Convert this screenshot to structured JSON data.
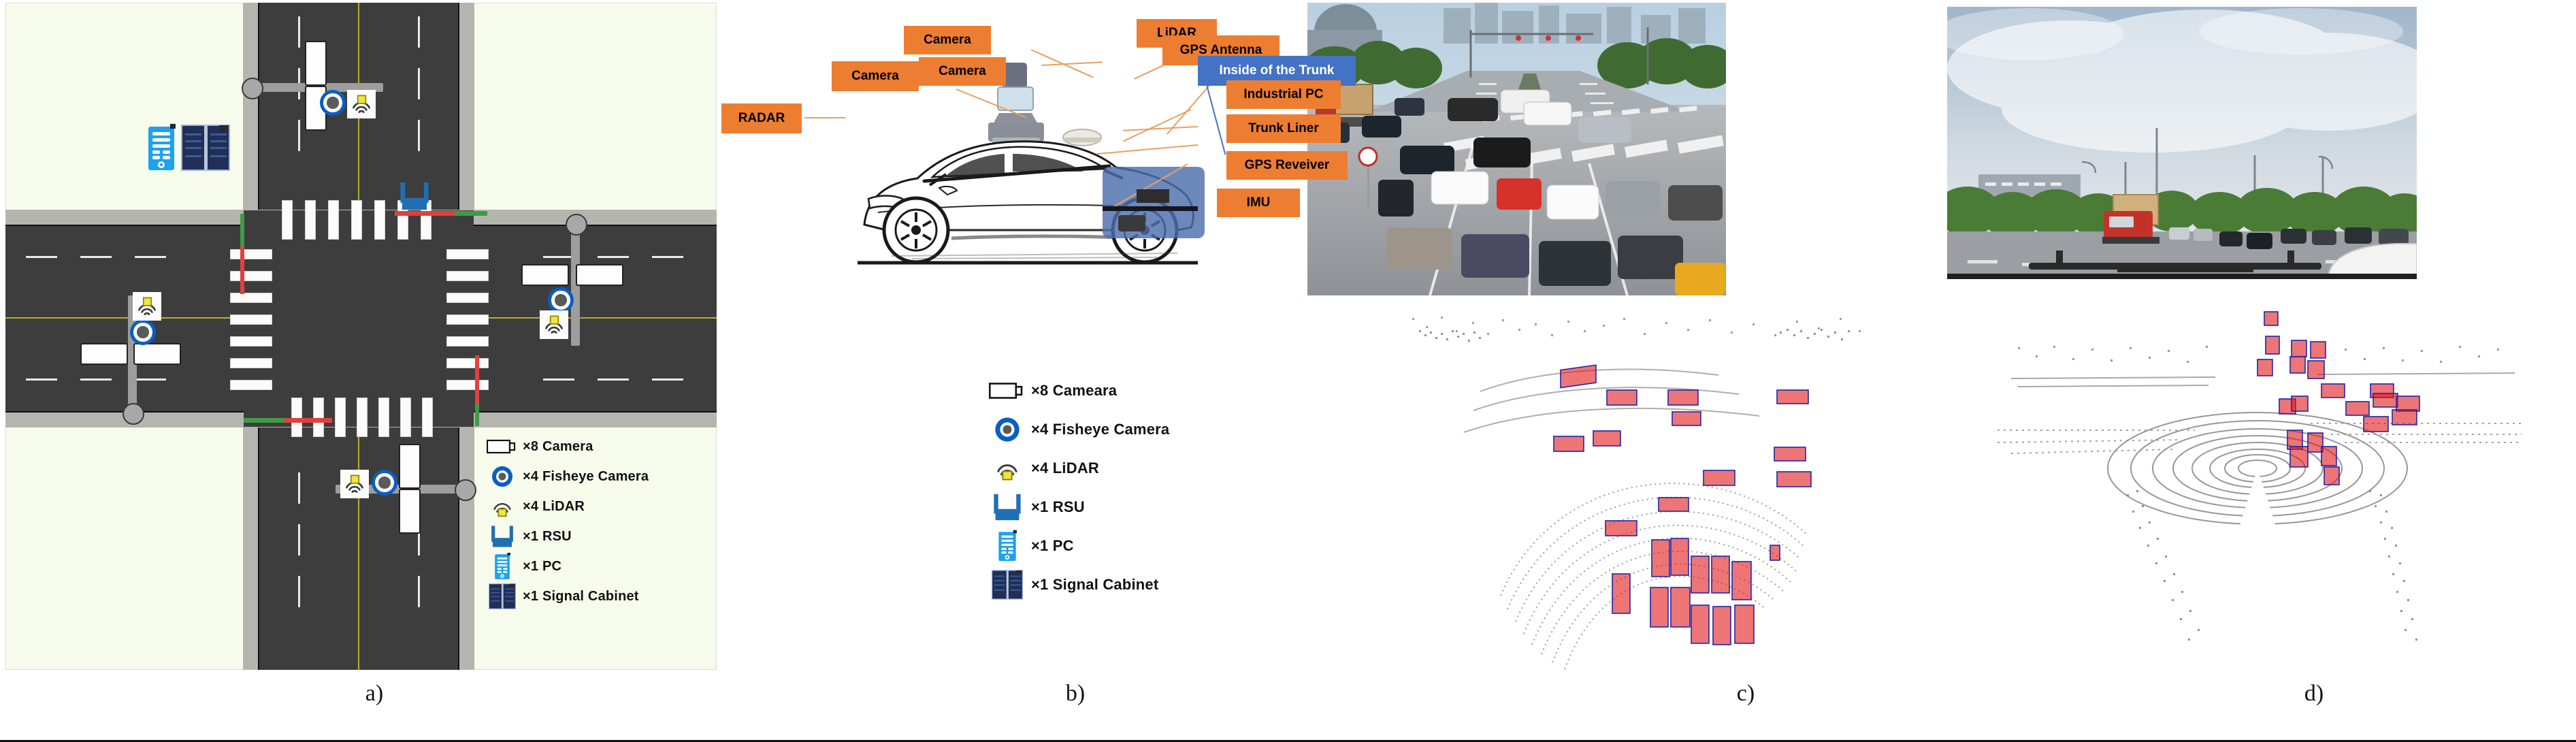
{
  "figure": {
    "captions": [
      {
        "id": "cap-a",
        "label": "a)"
      },
      {
        "id": "cap-b",
        "label": "b)"
      },
      {
        "id": "cap-c",
        "label": "c)"
      },
      {
        "id": "cap-d",
        "label": "d)"
      }
    ]
  },
  "panel_a": {
    "name": "roadside-infrastructure-layout",
    "legend_title": "",
    "legend": [
      {
        "icon": "camera-icon",
        "count": "×8",
        "label": "Camera",
        "text": "×8 Camera"
      },
      {
        "icon": "fisheye-camera-icon",
        "count": "×4",
        "label": "Fisheye Camera",
        "text": "×4 Fisheye Camera"
      },
      {
        "icon": "lidar-icon",
        "count": "×4",
        "label": "LiDAR",
        "text": "×4 LiDAR"
      },
      {
        "icon": "rsu-icon",
        "count": "×1",
        "label": "RSU",
        "text": "×1 RSU"
      },
      {
        "icon": "pc-icon",
        "count": "×1",
        "label": "PC",
        "text": "×1 PC"
      },
      {
        "icon": "signal-cabinet-icon",
        "count": "×1",
        "label": "Signal Cabinet",
        "text": "×1 Signal Cabinet"
      }
    ],
    "colors": {
      "background": "#f7fbec",
      "road": "#3d3d3d",
      "sidewalk": "#b5b5b0",
      "center_line": "#b9ad2a",
      "stopbar_red": "#e2403c",
      "stopbar_green": "#3f9b46",
      "rsu_blue": "#1F6FB5",
      "pc_blue": "#1CA2F0",
      "cabinet_navy": "#1f2f58",
      "fisheye_blue": "#0a5ec4"
    }
  },
  "panel_b": {
    "name": "vehicle-sensor-suite",
    "labels": [
      {
        "id": "camera-top-1",
        "text": "Camera",
        "style": "orange"
      },
      {
        "id": "camera-top-2",
        "text": "Camera",
        "style": "orange"
      },
      {
        "id": "lidar",
        "text": "LiDAR",
        "style": "orange"
      },
      {
        "id": "gps-antenna",
        "text": "GPS Antenna",
        "style": "orange"
      },
      {
        "id": "camera-side",
        "text": "Camera",
        "style": "orange"
      },
      {
        "id": "radar",
        "text": "RADAR",
        "style": "orange"
      },
      {
        "id": "inside-trunk",
        "text": "Inside of the Trunk",
        "style": "blue"
      },
      {
        "id": "industrial-pc",
        "text": "Industrial PC",
        "style": "orange"
      },
      {
        "id": "trunk-liner",
        "text": "Trunk Liner",
        "style": "orange"
      },
      {
        "id": "gps-receiver",
        "text": "GPS Reveiver",
        "style": "orange"
      },
      {
        "id": "imu",
        "text": "IMU",
        "style": "orange"
      }
    ],
    "legend": [
      {
        "icon": "camera-icon",
        "text": "×8 Cameara"
      },
      {
        "icon": "fisheye-camera-icon",
        "text": "×4 Fisheye Camera"
      },
      {
        "icon": "lidar-icon",
        "text": "×4 LiDAR"
      },
      {
        "icon": "rsu-icon",
        "text": "×1 RSU"
      },
      {
        "icon": "pc-icon",
        "text": "×1 PC"
      },
      {
        "icon": "signal-cabinet-icon",
        "text": "×1 Signal Cabinet"
      }
    ],
    "colors": {
      "tag_orange": "#ED7D31",
      "tag_blue": "#4472C4",
      "trunk_overlay": "#4d6fad"
    }
  },
  "panel_c": {
    "name": "roadside-view",
    "photo_alt": "Roadside camera view of a busy urban intersection with many cars",
    "cloud_alt": "Roadside LiDAR point cloud with red 3D bounding boxes around vehicles",
    "colors": {
      "point": "#8a8a8a",
      "box_edge": "#2222aa",
      "box_fill": "#e61e1e"
    }
  },
  "panel_d": {
    "name": "vehicle-view",
    "photo_alt": "Vehicle front camera view of an intersection with a red truck and cloudy sky",
    "cloud_alt": "Vehicle LiDAR point cloud with red 3D bounding boxes around vehicles",
    "colors": {
      "point": "#8a8a8a",
      "box_edge": "#2222aa",
      "box_fill": "#e61e1e"
    }
  }
}
